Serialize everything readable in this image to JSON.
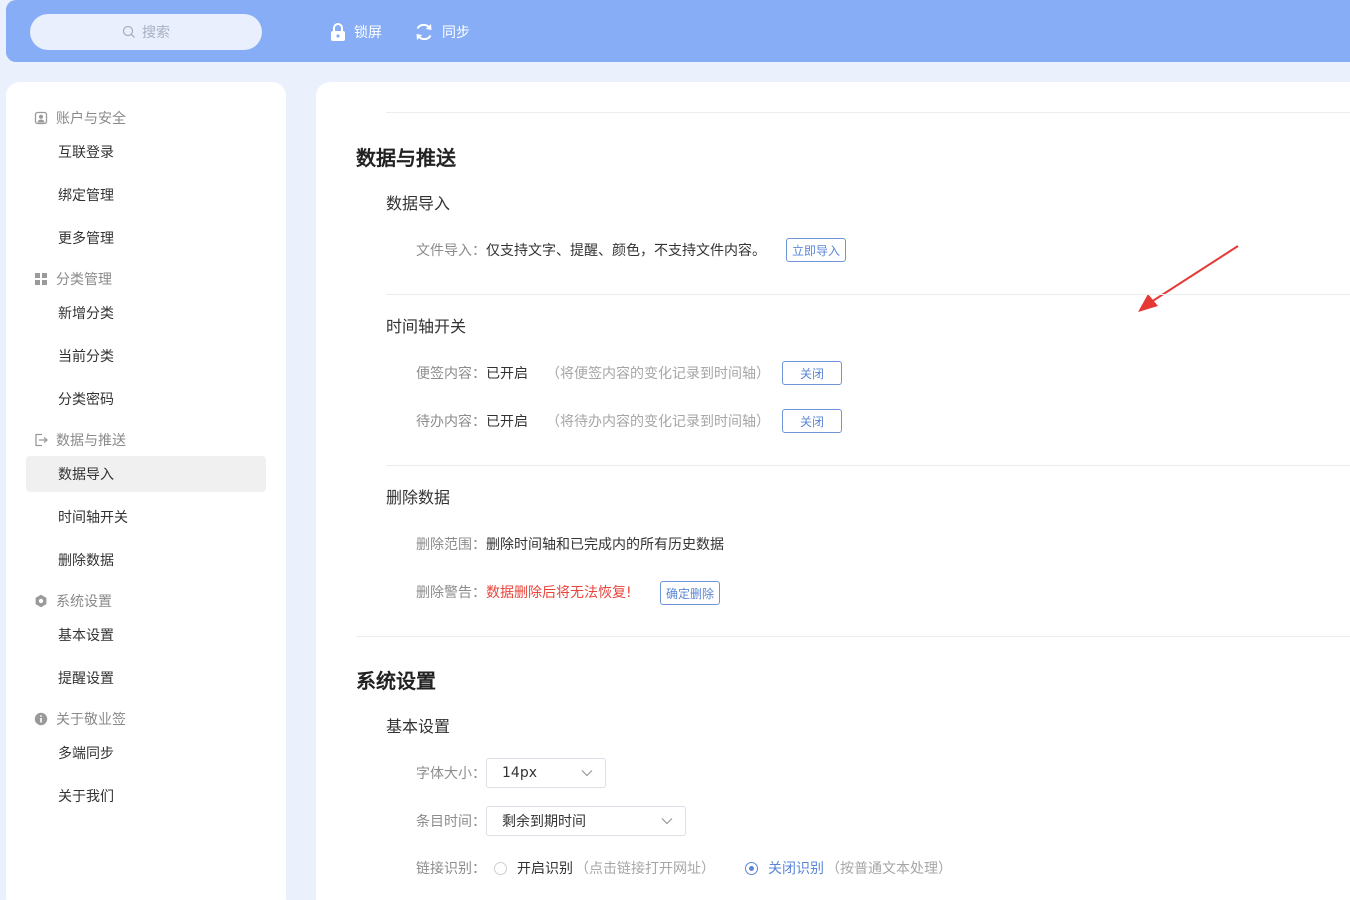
{
  "topbar": {
    "search_placeholder": "搜索",
    "lock_label": "锁屏",
    "sync_label": "同步"
  },
  "sidebar": {
    "groups": [
      {
        "title": "账户与安全",
        "icon": "account-icon",
        "items": [
          "互联登录",
          "绑定管理",
          "更多管理"
        ]
      },
      {
        "title": "分类管理",
        "icon": "grid-icon",
        "items": [
          "新增分类",
          "当前分类",
          "分类密码"
        ]
      },
      {
        "title": "数据与推送",
        "icon": "export-icon",
        "items": [
          "数据导入",
          "时间轴开关",
          "删除数据"
        ]
      },
      {
        "title": "系统设置",
        "icon": "gear-icon",
        "items": [
          "基本设置",
          "提醒设置"
        ]
      },
      {
        "title": "关于敬业签",
        "icon": "info-icon",
        "items": [
          "多端同步",
          "关于我们"
        ]
      }
    ],
    "active_item": "数据导入"
  },
  "main": {
    "data_section": {
      "title": "数据与推送",
      "import": {
        "title": "数据导入",
        "label": "文件导入：",
        "value": "仅支持文字、提醒、颜色，不支持文件内容。",
        "button": "立即导入"
      },
      "timeline": {
        "title": "时间轴开关",
        "note_label": "便签内容：",
        "note_value": "已开启",
        "note_hint": "（将便签内容的变化记录到时间轴）",
        "note_button": "关闭",
        "todo_label": "待办内容：",
        "todo_value": "已开启",
        "todo_hint": "（将待办内容的变化记录到时间轴）",
        "todo_button": "关闭"
      },
      "delete": {
        "title": "删除数据",
        "scope_label": "删除范围：",
        "scope_value": "删除时间轴和已完成内的所有历史数据",
        "warn_label": "删除警告：",
        "warn_value": "数据删除后将无法恢复!",
        "button": "确定删除"
      }
    },
    "system_section": {
      "title": "系统设置",
      "basic": {
        "title": "基本设置",
        "font_label": "字体大小：",
        "font_value": "14px",
        "time_label": "条目时间：",
        "time_value": "剩余到期时间",
        "link_label": "链接识别：",
        "link_on": "开启识别",
        "link_on_hint": "（点击链接打开网址）",
        "link_off": "关闭识别",
        "link_off_hint": "（按普通文本处理）",
        "link_selected": "off"
      }
    }
  },
  "colors": {
    "topbar": "#86adf5",
    "accent": "#5b86d6",
    "warning": "#e8453c",
    "annotation_arrow": "#e53935"
  }
}
